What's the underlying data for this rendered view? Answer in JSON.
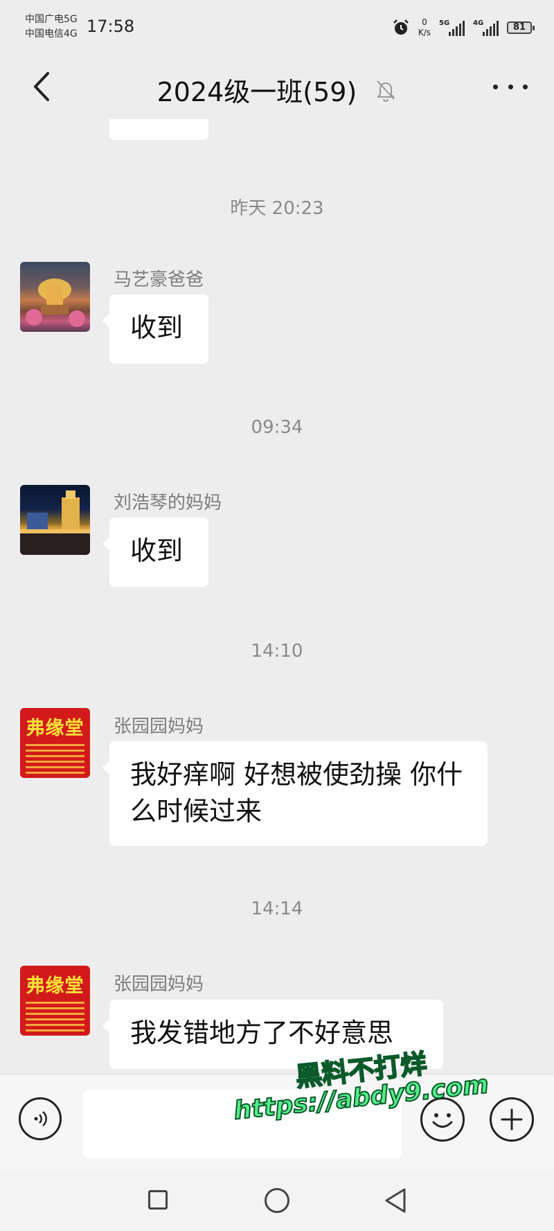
{
  "status_bar": {
    "carrier1": "中国广电5G",
    "carrier2": "中国电信4G",
    "time": "17:58",
    "net_speed_value": "0",
    "net_speed_unit": "K/s",
    "sim1_gen": "5G",
    "sim2_gen": "4G",
    "battery": "81"
  },
  "header": {
    "title": "2024级一班(59)",
    "muted_icon": "bell-off-icon"
  },
  "messages": [
    {
      "timestamp": "昨天 20:23",
      "sender": "马艺豪爸爸",
      "text": "收到",
      "avatar": "temple"
    },
    {
      "timestamp": "09:34",
      "sender": "刘浩琴的妈妈",
      "text": "收到",
      "avatar": "city-night"
    },
    {
      "timestamp": "14:10",
      "sender": "张园园妈妈",
      "text": "我好痒啊 好想被使劲操 你什么时候过来",
      "avatar": "red-shop",
      "avatar_text": "弗缘堂"
    },
    {
      "timestamp": "14:14",
      "sender": "张园园妈妈",
      "text": "我发错地方了不好意思",
      "avatar": "red-shop",
      "avatar_text": "弗缘堂"
    }
  ],
  "input_bar": {
    "voice_icon": "voice-icon",
    "text_value": "",
    "emoji_icon": "emoji-icon",
    "plus_icon": "plus-icon"
  },
  "watermark": {
    "line1": "黑料不打烊",
    "line2": "https://abdy9.com"
  },
  "colors": {
    "background": "#ededed",
    "bubble": "#ffffff",
    "timestamp": "#8a8a8a",
    "sender": "#7d7d7d",
    "watermark_fill": "#55ee88"
  }
}
